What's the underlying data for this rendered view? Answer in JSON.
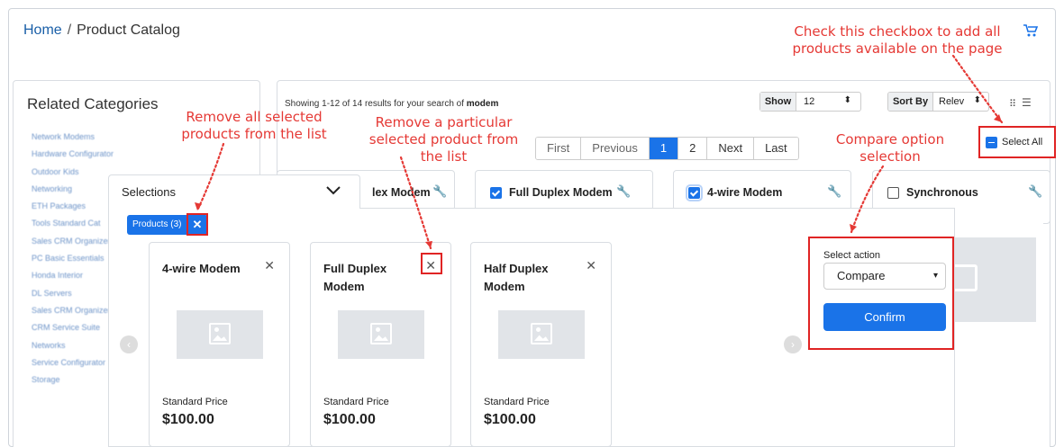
{
  "breadcrumb": {
    "home": "Home",
    "separator": "/",
    "current": "Product Catalog"
  },
  "sidebar": {
    "title": "Related Categories",
    "links": [
      "Network Modems",
      "Hardware Configurator",
      "Outdoor Kids",
      "Networking",
      "ETH Packages",
      "Tools Standard Cat",
      "Sales CRM Organizer",
      "PC Basic Essentials",
      "Honda Interior",
      "DL Servers",
      "Sales CRM Organizer",
      "CRM Service Suite",
      "Networks",
      "Service Configurator",
      "Storage"
    ]
  },
  "results": {
    "showing_prefix": "Showing 1-12 of 14 results for your search of ",
    "query": "modem",
    "show_label": "Show",
    "show_value": "12",
    "sort_label": "Sort By",
    "sort_value": "Relev",
    "select_all": "Select All"
  },
  "pagination": {
    "first": "First",
    "previous": "Previous",
    "pages": [
      "1",
      "2"
    ],
    "active_page": "1",
    "next": "Next",
    "last": "Last"
  },
  "product_cards": [
    {
      "name": "lex Modem",
      "checked": true
    },
    {
      "name": "Full Duplex Modem",
      "checked": true
    },
    {
      "name": "4-wire Modem",
      "checked": true
    },
    {
      "name": "Synchronous",
      "checked": false
    }
  ],
  "selections": {
    "title": "Selections",
    "chip": "Products (3)",
    "chip_close": "✕",
    "items": [
      {
        "name": "4-wire Modem",
        "price_label": "Standard Price",
        "price": "$100.00"
      },
      {
        "name": "Full Duplex Modem",
        "price_label": "Standard Price",
        "price": "$100.00"
      },
      {
        "name": "Half Duplex Modem",
        "price_label": "Standard Price",
        "price": "$100.00"
      }
    ],
    "action_label": "Select action",
    "action_value": "Compare",
    "confirm": "Confirm"
  },
  "annotations": {
    "select_all_1": "Check this checkbox to add all",
    "select_all_2": "products available on the page",
    "remove_all_1": "Remove all selected",
    "remove_all_2": "products from the list",
    "remove_one_1": "Remove a particular",
    "remove_one_2": "selected product from",
    "remove_one_3": "the list",
    "compare_1": "Compare option",
    "compare_2": "selection"
  },
  "colors": {
    "accent": "#1a73e8",
    "annotation": "#e53935",
    "link": "#1a5fa8"
  }
}
